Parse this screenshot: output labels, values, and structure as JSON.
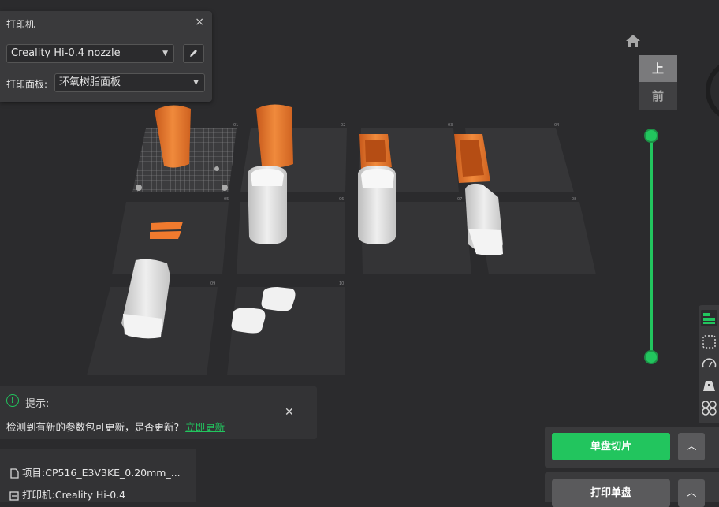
{
  "printer_panel": {
    "title": "打印机",
    "close_icon": "×",
    "printer_select": "Creality Hi-0.4 nozzle",
    "plate_label": "打印面板:",
    "plate_select": "环氧树脂面板"
  },
  "view_cube": {
    "top_label": "上",
    "front_label": "前"
  },
  "notice": {
    "title": "提示:",
    "message": "检测到有新的参数包可更新，是否更新?",
    "link": "立即更新",
    "close_icon": "✕"
  },
  "project": {
    "project_line": "项目:CP516_E3V3KE_0.20mm_...",
    "printer_line": "打印机:Creality Hi-0.4"
  },
  "actions": {
    "slice_label": "单盘切片",
    "print_label": "打印单盘",
    "expand_icon": "︿"
  },
  "colors": {
    "accent": "#22c55e",
    "orange_part": "#e8742a",
    "white_part": "#d9d9d9",
    "background": "#2b2b2d"
  },
  "plates": [
    {
      "number": "01"
    },
    {
      "number": "02"
    },
    {
      "number": "03"
    },
    {
      "number": "04"
    },
    {
      "number": "05"
    },
    {
      "number": "06"
    },
    {
      "number": "07"
    },
    {
      "number": "08"
    },
    {
      "number": "09"
    },
    {
      "number": "10"
    }
  ],
  "toolbar_icons": [
    "arrange-icon",
    "layout-icon",
    "speed-icon",
    "support-icon",
    "clover-icon"
  ]
}
